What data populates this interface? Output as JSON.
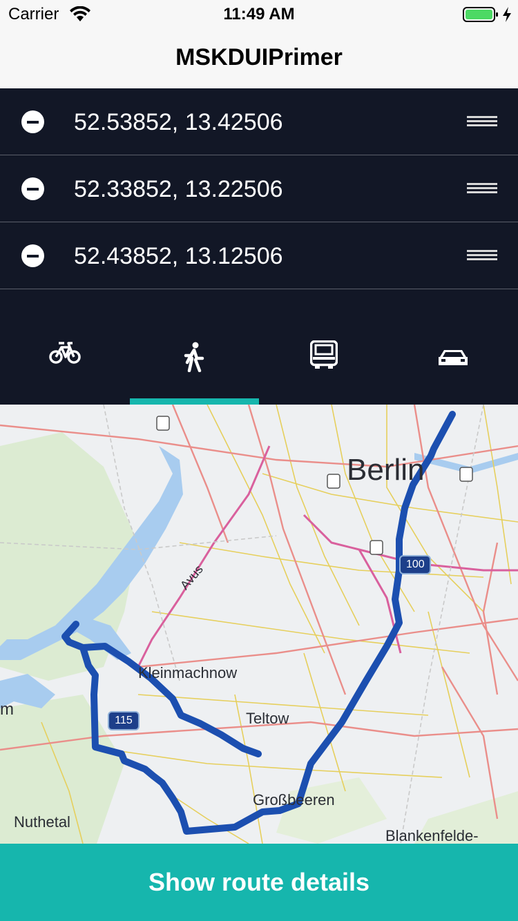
{
  "status_bar": {
    "carrier": "Carrier",
    "time": "11:49 AM"
  },
  "nav": {
    "title": "MSKDUIPrimer"
  },
  "waypoints": [
    {
      "coords": "52.53852, 13.42506"
    },
    {
      "coords": "52.33852, 13.22506"
    },
    {
      "coords": "52.43852, 13.12506"
    }
  ],
  "modes": [
    {
      "icon": "bicycle-icon",
      "selected": false
    },
    {
      "icon": "walking-icon",
      "selected": true
    },
    {
      "icon": "bus-icon",
      "selected": false
    },
    {
      "icon": "car-icon",
      "selected": false
    }
  ],
  "map": {
    "labels": {
      "berlin": "Berlin",
      "kleinmachnow": "Kleinmachnow",
      "teltow": "Teltow",
      "grossbeeren": "Großbeeren",
      "nuthetal": "Nuthetal",
      "blankenfelde": "Blankenfelde-",
      "partial_m": "m",
      "avus": "Avus"
    },
    "shields": {
      "r100": "100",
      "r115": "115"
    },
    "route_color": "#1c4fb0"
  },
  "bottom_button": {
    "label": "Show route details"
  },
  "colors": {
    "accent": "#16b6ad",
    "panel": "#121726"
  }
}
